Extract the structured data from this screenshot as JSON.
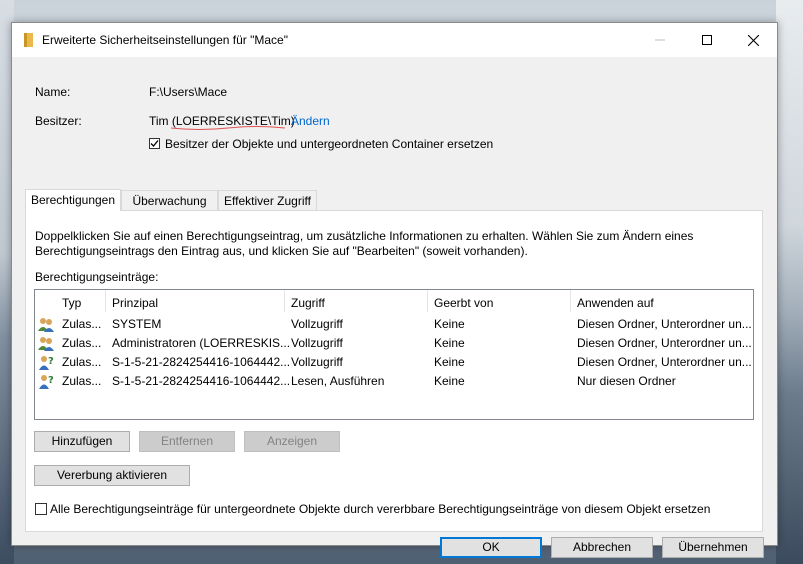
{
  "window": {
    "title": "Erweiterte Sicherheitseinstellungen für \"Mace\""
  },
  "name_row": {
    "label": "Name:",
    "value": "F:\\Users\\Mace"
  },
  "owner_row": {
    "label": "Besitzer:",
    "value": "Tim (LOERRESKISTE\\Tim)",
    "change_link": "Ändern"
  },
  "replace_owner_checkbox": {
    "label": "Besitzer der Objekte und untergeordneten Container ersetzen",
    "checked": true
  },
  "tabs": [
    {
      "label": "Berechtigungen",
      "active": true
    },
    {
      "label": "Überwachung",
      "active": false
    },
    {
      "label": "Effektiver Zugriff",
      "active": false
    }
  ],
  "description": "Doppelklicken Sie auf einen Berechtigungseintrag, um zusätzliche Informationen zu erhalten. Wählen Sie zum Ändern eines Berechtigungseintrags den Eintrag aus, und klicken Sie auf \"Bearbeiten\" (soweit vorhanden).",
  "entries_label": "Berechtigungseinträge:",
  "table": {
    "columns": [
      "Typ",
      "Prinzipal",
      "Zugriff",
      "Geerbt von",
      "Anwenden auf"
    ],
    "rows": [
      {
        "icon": "user-group-icon",
        "typ": "Zulas...",
        "prinzipal": "SYSTEM",
        "zugriff": "Vollzugriff",
        "geerbt": "Keine",
        "anwenden": "Diesen Ordner, Unterordner un..."
      },
      {
        "icon": "user-group-icon",
        "typ": "Zulas...",
        "prinzipal": "Administratoren (LOERRESKIS...",
        "zugriff": "Vollzugriff",
        "geerbt": "Keine",
        "anwenden": "Diesen Ordner, Unterordner un..."
      },
      {
        "icon": "unknown-user-icon",
        "typ": "Zulas...",
        "prinzipal": "S-1-5-21-2824254416-1064442...",
        "zugriff": "Vollzugriff",
        "geerbt": "Keine",
        "anwenden": "Diesen Ordner, Unterordner un..."
      },
      {
        "icon": "unknown-user-icon",
        "typ": "Zulas...",
        "prinzipal": "S-1-5-21-2824254416-1064442...",
        "zugriff": "Lesen, Ausführen",
        "geerbt": "Keine",
        "anwenden": "Nur diesen Ordner"
      }
    ]
  },
  "buttons": {
    "add": "Hinzufügen",
    "remove": "Entfernen",
    "view": "Anzeigen",
    "enable_inheritance": "Vererbung aktivieren",
    "ok": "OK",
    "cancel": "Abbrechen",
    "apply": "Übernehmen"
  },
  "replace_child_checkbox": {
    "label": "Alle Berechtigungseinträge für untergeordnete Objekte durch vererbbare Berechtigungseinträge von diesem Objekt ersetzen",
    "checked": false
  },
  "colors": {
    "link": "#0066cc",
    "accent": "#0078d7",
    "spell_underline": "#e05050"
  }
}
